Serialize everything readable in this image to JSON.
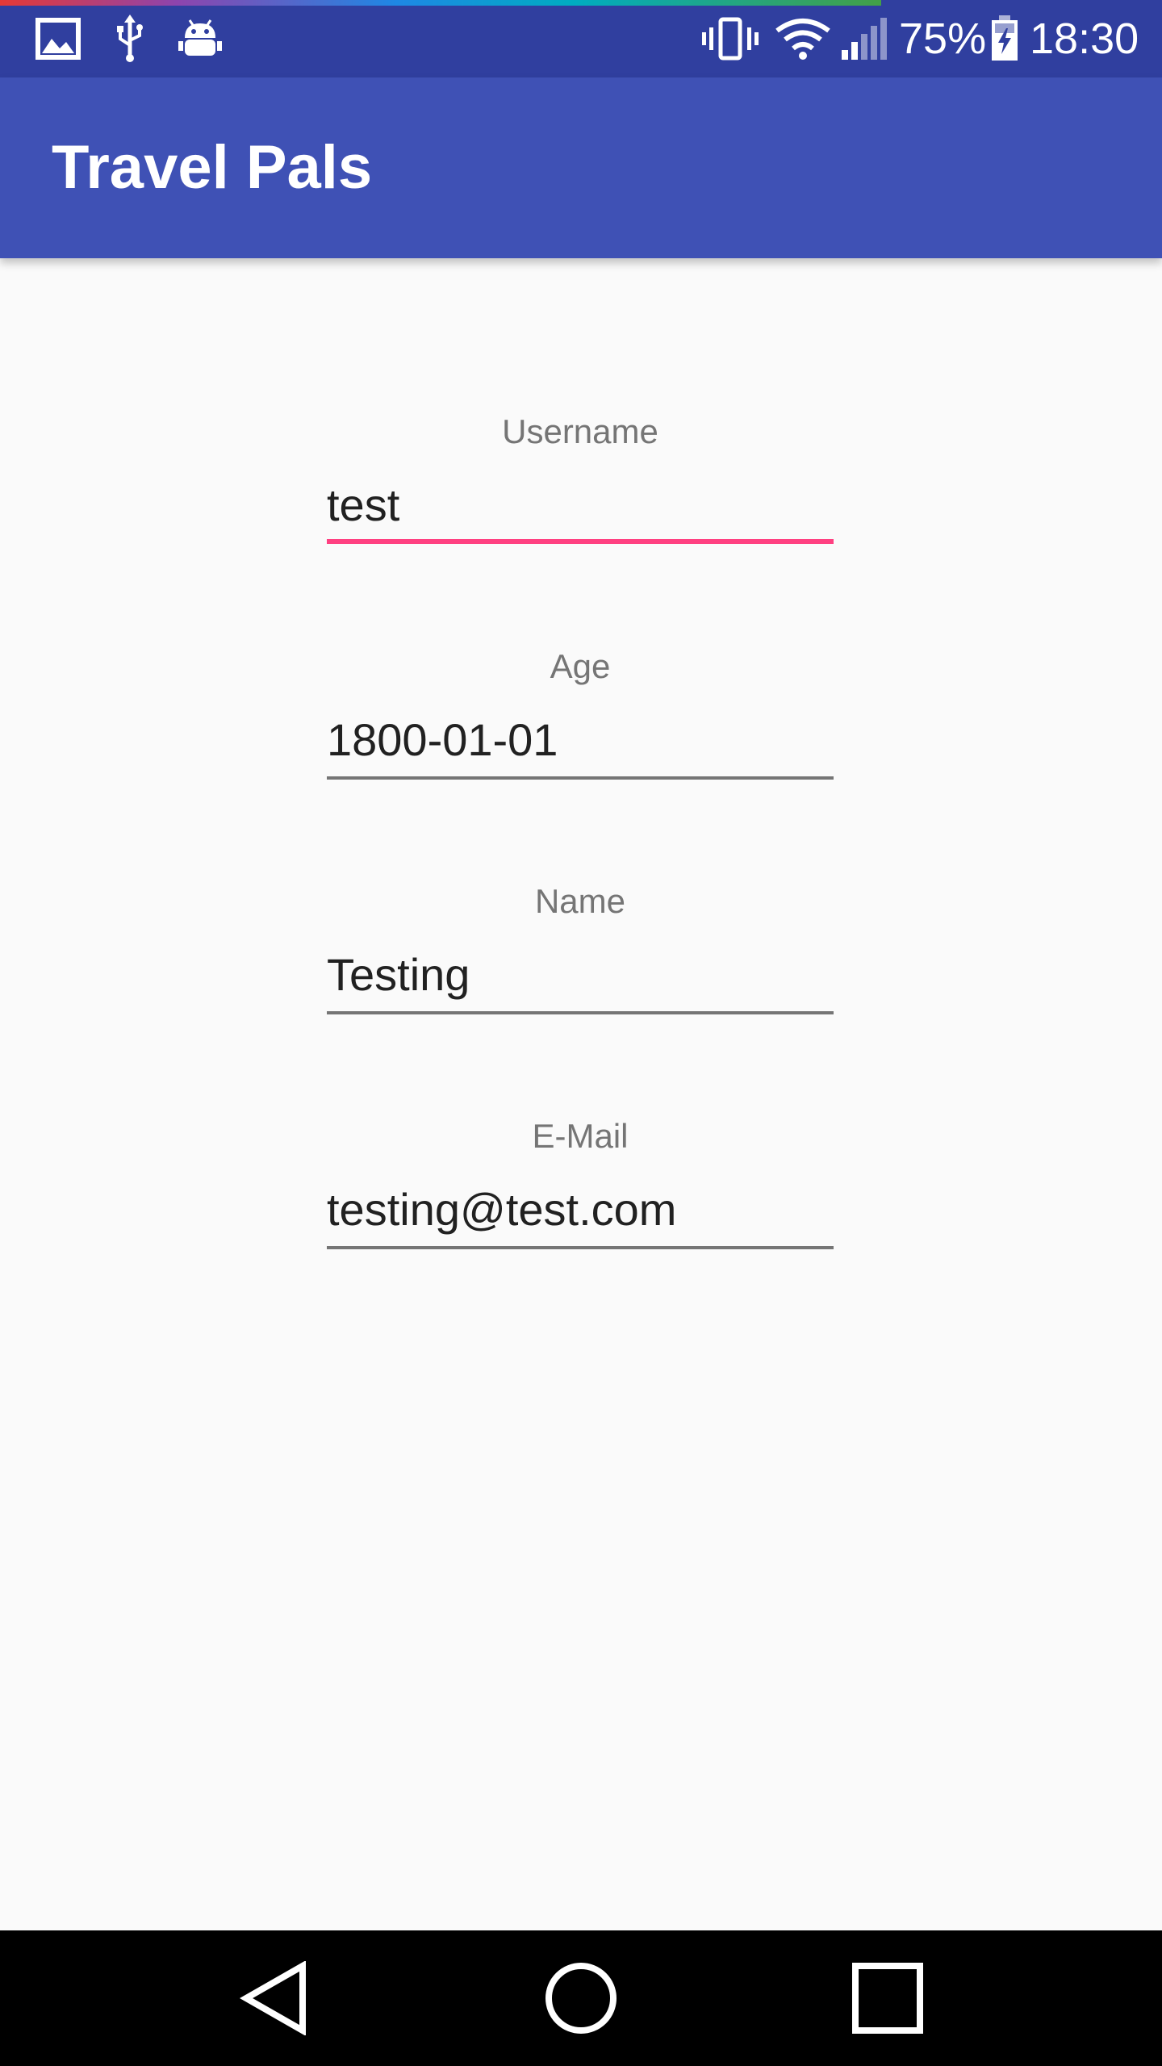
{
  "status_bar": {
    "left_icons": [
      "image-icon",
      "usb-icon",
      "android-debug-icon"
    ],
    "right_icons": [
      "vibrate-icon",
      "wifi-icon",
      "signal-icon",
      "battery-charging-icon"
    ],
    "battery_percent": "75%",
    "time": "18:30"
  },
  "app_bar": {
    "title": "Travel Pals"
  },
  "form": {
    "fields": [
      {
        "label": "Username",
        "value": "test",
        "focused": true
      },
      {
        "label": "Age",
        "value": "1800-01-01",
        "focused": false
      },
      {
        "label": "Name",
        "value": "Testing",
        "focused": false
      },
      {
        "label": "E-Mail",
        "value": "testing@test.com",
        "focused": false
      }
    ]
  },
  "nav_bar": {
    "buttons": [
      "back-icon",
      "home-icon",
      "recents-icon"
    ]
  },
  "colors": {
    "status_bar": "#303f9f",
    "primary": "#3f51b5",
    "accent": "#ff4081",
    "background": "#fafafa",
    "text_primary": "#212121",
    "text_secondary": "#757575"
  }
}
